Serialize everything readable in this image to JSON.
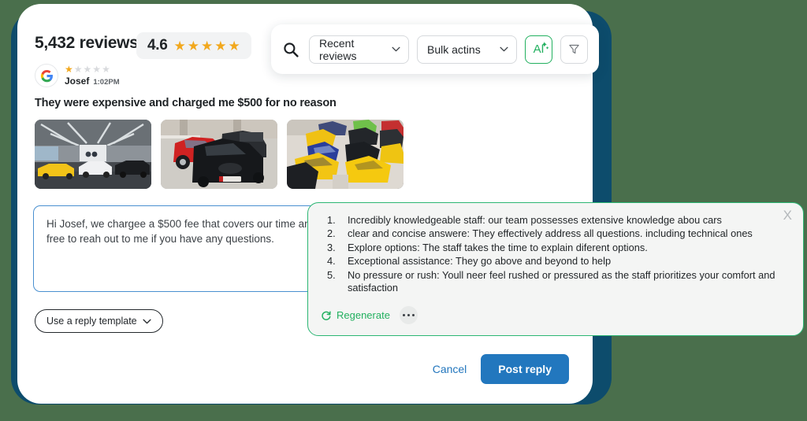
{
  "header": {
    "review_count": "5,432 reviews",
    "rating_value": "4.6",
    "rating_stars": 5
  },
  "toolbar": {
    "search_icon": "search-icon",
    "sort_select": "Recent reviews",
    "bulk_select": "Bulk actins",
    "ai_label": "AI",
    "filter_icon": "filter-icon"
  },
  "review": {
    "source_icon": "google-logo-icon",
    "stars_filled": 1,
    "stars_total": 5,
    "author": "Josef",
    "time": "1:02PM",
    "title": "They were expensive and charged me $500 for no reason",
    "photos": [
      {
        "name": "photo-showroom-supercars",
        "alt": "Showroom with yellow and white supercars"
      },
      {
        "name": "photo-lot-red-audi",
        "alt": "Car lot with red and black Audi vehicles"
      },
      {
        "name": "photo-overhead-colorful-cars",
        "alt": "Overhead view of colorful sports cars"
      }
    ]
  },
  "reply": {
    "text": "Hi Josef, we chargee a $500 fee that covers our time and expertise with our customers.. Please feel free to reah out to me if you have any questions.",
    "template_button": "Use a reply template",
    "cancel_label": "Cancel",
    "post_label": "Post reply"
  },
  "ai_popup": {
    "close_label": "X",
    "suggestions": [
      "Incredibly knowledgeable staff: our team possesses extensive knowledge abou cars",
      "clear and concise answere: They effectively address all questions. including technical ones",
      "Explore options: The staff takes the time to explain diferent options.",
      "Exceptional assistance: They go above and beyond to help",
      "No pressure or rush: Youll neer feel rushed or pressured as the staff prioritizes your comfort and satisfaction"
    ],
    "regenerate_label": "Regenerate",
    "more_label": "more-options"
  },
  "colors": {
    "page_background": "#4a6f4c",
    "frame": "#0d4c6c",
    "card": "#ffffff",
    "accent_blue": "#2277be",
    "accent_green": "#22b05f",
    "star_gold": "#f2a81d"
  }
}
